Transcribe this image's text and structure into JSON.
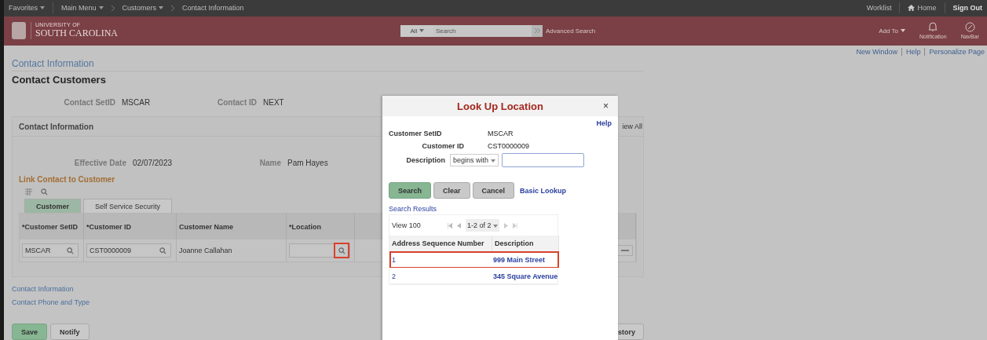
{
  "top_bar": {
    "menus": [
      {
        "label": "Favorites"
      },
      {
        "label": "Main Menu"
      }
    ],
    "breadcrumbs": [
      {
        "label": "Customers",
        "dropdown": true
      },
      {
        "label": "Contact Information",
        "dropdown": false
      }
    ],
    "right_links": [
      {
        "label": "Worklist",
        "kind": "text"
      },
      {
        "label": "Home",
        "kind": "home"
      },
      {
        "label": "Sign Out",
        "kind": "bold"
      }
    ]
  },
  "banner": {
    "logo_small": "UNIVERSITY OF",
    "logo_large": "SOUTH CAROLINA",
    "search": {
      "scope": "All",
      "placeholder": "Search"
    },
    "advanced_search": "Advanced Search",
    "add_to": "Add To",
    "actions": [
      {
        "label": "Notification",
        "kind": "bell"
      },
      {
        "label": "NavBar",
        "kind": "compass"
      }
    ]
  },
  "page_links": [
    "New Window",
    "Help",
    "Personalize Page"
  ],
  "page": {
    "breadcrumb_title": "Contact Information",
    "heading": "Contact Customers",
    "key_fields": [
      {
        "label": "Contact SetID",
        "value": "MSCAR"
      },
      {
        "label": "Contact ID",
        "value": "NEXT"
      }
    ],
    "section": {
      "title": "Contact Information",
      "view_all": "iew All",
      "fields": [
        {
          "label": "Effective Date",
          "value": "02/07/2023"
        },
        {
          "label": "Name",
          "value": "Pam Hayes"
        }
      ],
      "group_title": "Link Contact to Customer",
      "tabs": [
        {
          "label": "Customer",
          "selected": true
        },
        {
          "label": "Self Service Security",
          "selected": false
        }
      ],
      "columns": [
        "*Customer SetID",
        "*Customer ID",
        "Customer Name",
        "*Location"
      ],
      "rows": [
        {
          "cells": [
            {
              "kind": "lookup",
              "value": "MSCAR",
              "highlighted": false
            },
            {
              "kind": "lookup",
              "value": "CST0000009",
              "highlighted": false
            },
            {
              "kind": "text",
              "value": "Joanne Callahan"
            },
            {
              "kind": "lookup",
              "highlighted": true
            }
          ]
        }
      ]
    },
    "links": [
      "Contact Information",
      "Contact Phone and Type"
    ],
    "buttons": [
      {
        "label": "Save",
        "kind": "primary"
      },
      {
        "label": "Notify",
        "kind": "secondary"
      }
    ],
    "partial_button": "story"
  },
  "modal": {
    "title": "Look Up Location",
    "close": "×",
    "help": "Help",
    "fields": [
      {
        "label": "Customer SetID",
        "value": "MSCAR"
      },
      {
        "label": "Customer ID",
        "value": "CST0000009"
      }
    ],
    "description": {
      "label": "Description",
      "operator": "begins with"
    },
    "buttons": [
      {
        "label": "Search",
        "kind": "primary"
      },
      {
        "label": "Clear",
        "kind": "secondary"
      },
      {
        "label": "Cancel",
        "kind": "secondary"
      }
    ],
    "basic_lookup": "Basic Lookup",
    "results_title": "Search Results",
    "grid": {
      "view": "View 100",
      "range": "1-2 of 2",
      "columns": [
        "Address Sequence Number",
        "Description"
      ],
      "rows": [
        {
          "cells": [
            "1",
            "999 Main Street"
          ],
          "highlighted": true
        },
        {
          "cells": [
            "2",
            "345 Square Avenue"
          ],
          "highlighted": false
        }
      ]
    }
  }
}
